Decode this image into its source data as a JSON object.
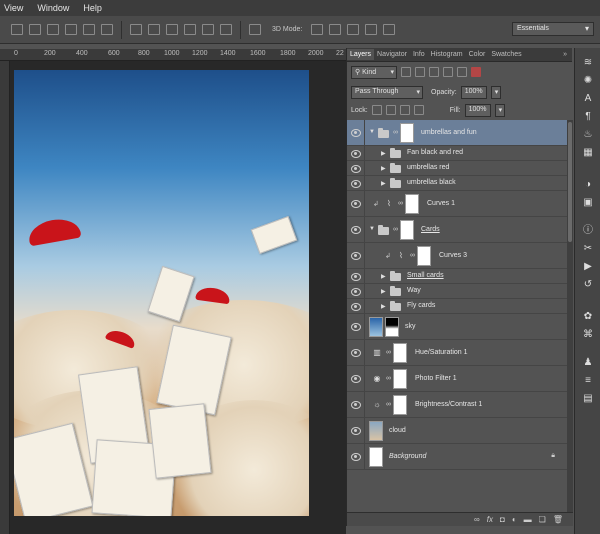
{
  "menu": {
    "items": [
      "View",
      "Window",
      "Help"
    ]
  },
  "options": {
    "mode_label": "3D Mode:"
  },
  "workspace": {
    "value": "Essentials"
  },
  "ruler": {
    "ticks": [
      "0",
      "200",
      "400",
      "600",
      "800",
      "1000",
      "1200",
      "1400",
      "1600",
      "1800",
      "2000",
      "22"
    ]
  },
  "panel": {
    "tabs": [
      "Layers",
      "Navigator",
      "Info",
      "Histogram",
      "Color",
      "Swatches"
    ],
    "more": "»",
    "filter": {
      "kind": "Kind"
    },
    "blend": {
      "mode": "Pass Through",
      "opacity_label": "Opacity:",
      "opacity": "100%"
    },
    "lock": {
      "label": "Lock:",
      "fill_label": "Fill:",
      "fill": "100%"
    },
    "layers": [
      {
        "name": "umbrellas and fun",
        "type": "group-mask",
        "indent": 0,
        "expanded": true,
        "selected": true,
        "visible": true
      },
      {
        "name": "Fan black and red",
        "type": "group",
        "indent": 1,
        "expanded": false,
        "visible": true
      },
      {
        "name": "umbrellas red",
        "type": "group",
        "indent": 1,
        "expanded": false,
        "visible": true
      },
      {
        "name": "umbrellas black",
        "type": "group",
        "indent": 1,
        "expanded": false,
        "visible": true
      },
      {
        "name": "Curves 1",
        "type": "adjustment-curves",
        "indent": 1,
        "visible": true,
        "clipped": true
      },
      {
        "name": "Cards",
        "type": "group-mask",
        "indent": 1,
        "expanded": true,
        "visible": true,
        "underline": true
      },
      {
        "name": "Curves 3",
        "type": "adjustment-curves",
        "indent": 2,
        "visible": true,
        "clipped": true
      },
      {
        "name": "Small cards",
        "type": "group",
        "indent": 2,
        "expanded": false,
        "visible": true,
        "underline": true
      },
      {
        "name": "Way",
        "type": "group",
        "indent": 2,
        "expanded": false,
        "visible": true
      },
      {
        "name": "Fly cards",
        "type": "group",
        "indent": 2,
        "expanded": false,
        "visible": true
      },
      {
        "name": "sky",
        "type": "image-mask",
        "indent": 0,
        "visible": true
      },
      {
        "name": "Hue/Saturation 1",
        "type": "adjustment-hue",
        "indent": 0,
        "visible": true
      },
      {
        "name": "Photo Filter 1",
        "type": "adjustment-photo",
        "indent": 0,
        "visible": true
      },
      {
        "name": "Brightness/Contrast 1",
        "type": "adjustment-brightness",
        "indent": 0,
        "visible": true
      },
      {
        "name": "cloud",
        "type": "image",
        "indent": 0,
        "visible": true
      },
      {
        "name": "Background",
        "type": "background",
        "indent": 0,
        "visible": true,
        "italic": true,
        "locked": true
      }
    ],
    "footer_icons": [
      "link-icon",
      "fx-icon",
      "mask-icon",
      "adjustment-icon",
      "folder-icon",
      "new-layer-icon",
      "trash-icon"
    ]
  }
}
